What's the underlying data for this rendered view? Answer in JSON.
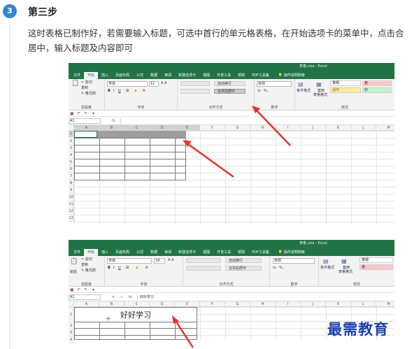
{
  "step": {
    "number": "3",
    "title": "第三步",
    "description": "这时表格已制作好，若需要输入标题，可选中首行的单元格表格，在开始选项卡的菜单中，点击合居中，输入标题及内容即可"
  },
  "colors": {
    "excel_green": "#217346",
    "step_blue": "#2f86d6",
    "arrow_red": "#e0352b",
    "watermark_blue": "#1d3fb0"
  },
  "screenshot1": {
    "window_title": "表格.xlsx - Excel",
    "tabs": [
      "文件",
      "开始",
      "插入",
      "页面布局",
      "公式",
      "数据",
      "审阅",
      "新建选项卡",
      "视图",
      "开发工具",
      "帮助",
      "PDF工具集"
    ],
    "active_tab": "开始",
    "search": "操作说明搜索",
    "clipboard": {
      "cut": "✂ 剪切",
      "copy": "复制",
      "format_painter": "✎ 格式刷",
      "group": "剪贴板"
    },
    "font": {
      "name": "宋体",
      "size": "11",
      "group": "字体"
    },
    "alignment": {
      "wrap": "自动换行",
      "merge": "合并后居中",
      "group": "对齐方式"
    },
    "number": {
      "format": "常规",
      "group": "数字"
    },
    "styles": {
      "conditional": "条件格式",
      "table": "套用",
      "table2": "表格格式",
      "normal": "常规",
      "bad": "差",
      "good": "好",
      "neutral": "适中",
      "group": "样式"
    },
    "name_box": "A1",
    "fx": "fx",
    "formula_content": "",
    "columns": [
      "A",
      "B",
      "C",
      "D",
      "E",
      "F",
      "G",
      "H",
      "I",
      "J",
      "K",
      "L",
      "M"
    ],
    "rows": [
      "1",
      "2",
      "3",
      "4",
      "5",
      "6",
      "7",
      "8",
      "9",
      "10",
      "11",
      "12",
      "13"
    ]
  },
  "screenshot2": {
    "window_title": "表格.xlsx - Excel",
    "tabs": [
      "文件",
      "开始",
      "插入",
      "页面布局",
      "公式",
      "数据",
      "审阅",
      "新建选项卡",
      "视图",
      "开发工具",
      "帮助",
      "PDF工具集"
    ],
    "active_tab": "开始",
    "search": "操作说明搜索",
    "clipboard": {
      "cut": "✂ 剪切",
      "copy": "复制",
      "paste": "粘贴",
      "format_painter": "✎ 格式刷",
      "group": "剪贴板"
    },
    "font": {
      "name": "宋体",
      "size": "18",
      "group": "字体"
    },
    "alignment": {
      "wrap": "自动换行",
      "merge": "合并后居中",
      "group": "对齐方式"
    },
    "number": {
      "format": "常规",
      "group": "数字"
    },
    "styles": {
      "conditional": "条件格式",
      "table": "套用",
      "table2": "表格格式",
      "normal": "常规",
      "bad": "差",
      "group": "样式"
    },
    "name_box": "A1",
    "cancel": "✕",
    "enter": "✓",
    "fx": "fx",
    "formula_content": "好好学习",
    "columns": [
      "A",
      "B",
      "C",
      "D",
      "E",
      "F",
      "G",
      "H",
      "I",
      "J",
      "K",
      "L",
      "M"
    ],
    "rows": [
      "1",
      "2",
      "3",
      "4"
    ],
    "merged_title": "好好学习"
  },
  "watermark": "最需教育"
}
